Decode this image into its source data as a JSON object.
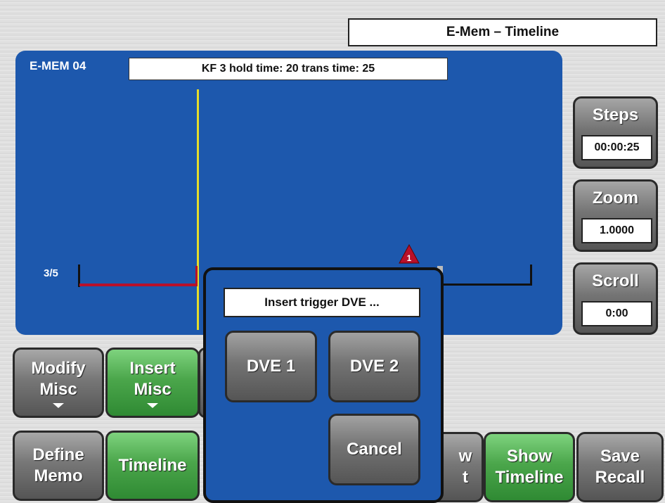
{
  "header": {
    "title": "E-Mem – Timeline"
  },
  "timeline": {
    "memo_label": "E-MEM 04",
    "keyframe_info": "KF 3 hold time: 20 trans time: 25",
    "track_label": "3/5",
    "marker_number": "1"
  },
  "side_controls": {
    "steps": {
      "label": "Steps",
      "value": "00:00:25"
    },
    "zoom": {
      "label": "Zoom",
      "value": "1.0000"
    },
    "scroll": {
      "label": "Scroll",
      "value": "0:00"
    }
  },
  "buttons": {
    "modify_misc": [
      "Modify",
      "Misc"
    ],
    "insert_misc": [
      "Insert",
      "Misc"
    ],
    "define_memo": [
      "Define",
      "Memo"
    ],
    "timeline": "Timeline",
    "show_next_partial": [
      "w",
      "t"
    ],
    "show_timeline": [
      "Show",
      "Timeline"
    ],
    "save_recall": [
      "Save",
      "Recall"
    ]
  },
  "dialog": {
    "title": "Insert trigger DVE ...",
    "dve1": "DVE 1",
    "dve2": "DVE 2",
    "cancel": "Cancel"
  },
  "colors": {
    "panel_blue": "#1d58ad",
    "active_green": "#4ba64b",
    "cursor_yellow": "#e6dd2a",
    "marker_red": "#b8102a"
  }
}
